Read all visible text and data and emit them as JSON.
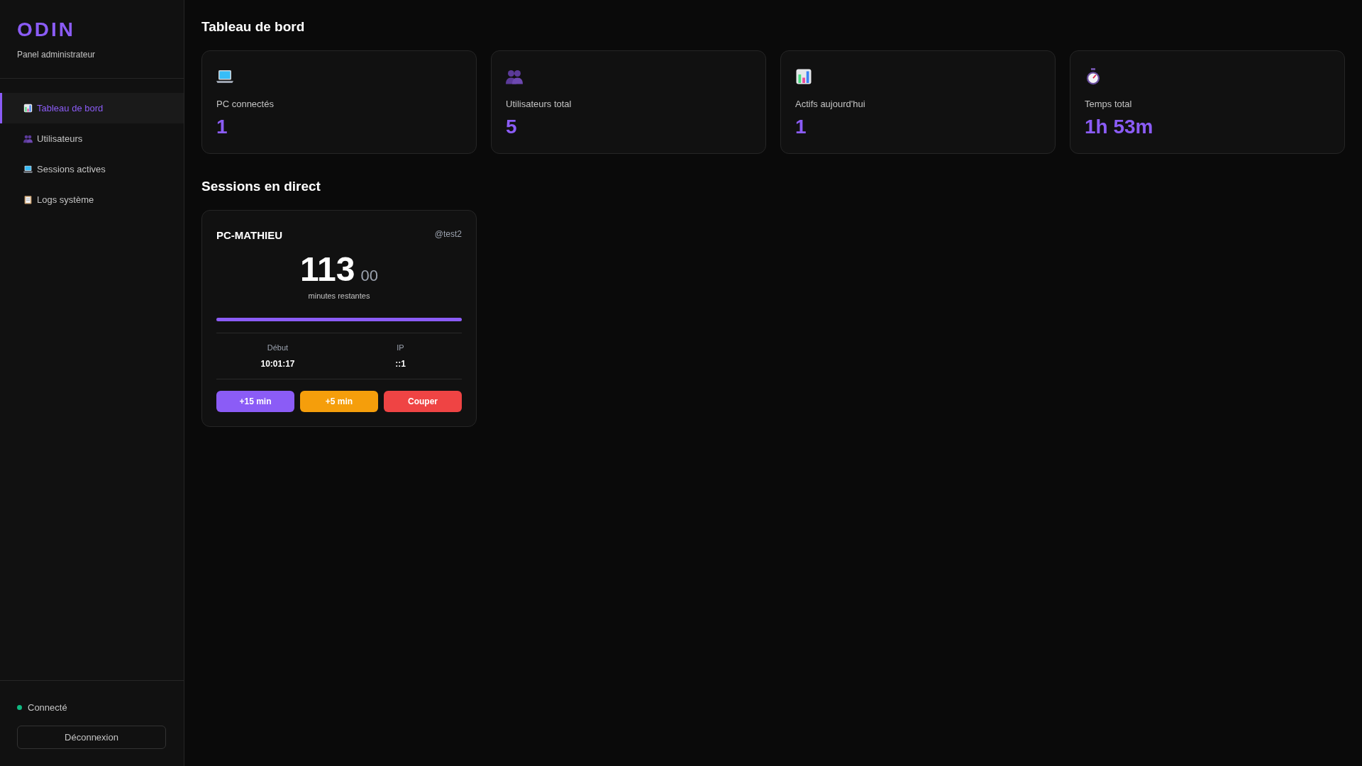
{
  "sidebar": {
    "logo": "ODIN",
    "subtitle": "Panel administrateur",
    "items": [
      {
        "label": "Tableau de bord",
        "selected": true
      },
      {
        "label": "Utilisateurs",
        "selected": false
      },
      {
        "label": "Sessions actives",
        "selected": false
      },
      {
        "label": "Logs système",
        "selected": false
      }
    ],
    "status": {
      "label": "Connecté",
      "color": "#10b981"
    },
    "logout": "Déconnexion"
  },
  "page_title": "Tableau de bord",
  "stats": [
    {
      "label": "PC connectés",
      "value": "1"
    },
    {
      "label": "Utilisateurs total",
      "value": "5"
    },
    {
      "label": "Actifs aujourd'hui",
      "value": "1"
    },
    {
      "label": "Temps total",
      "value": "1h 53m"
    }
  ],
  "sessions_title": "Sessions en direct",
  "sessions": [
    {
      "pc": "PC-MATHIEU",
      "user": "@test2",
      "minutes": "113",
      "seconds": "00",
      "caption": "minutes restantes",
      "level": 1,
      "details": [
        {
          "label": "Début",
          "value": "10:01:17"
        },
        {
          "label": "IP",
          "value": "::1"
        }
      ],
      "actions": [
        {
          "label": "+15 min",
          "kind": "add"
        },
        {
          "label": "+5 min",
          "kind": "warn"
        },
        {
          "label": "Couper",
          "kind": "stop"
        }
      ]
    }
  ]
}
